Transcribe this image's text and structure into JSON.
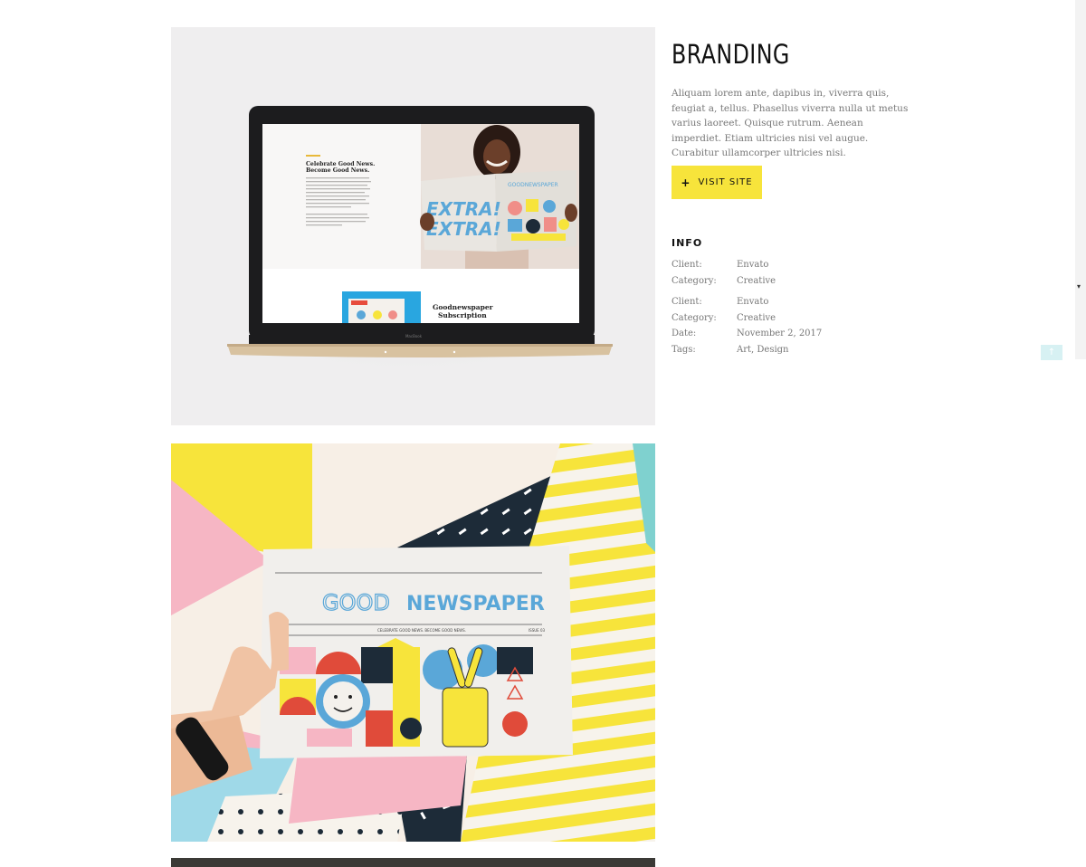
{
  "project": {
    "title": "BRANDING",
    "description": "Aliquam lorem ante, dapibus in, viverra quis, feugiat a, tellus. Phasellus viverra nulla ut metus varius laoreet. Quisque rutrum. Aenean imperdiet. Etiam ultricies nisi vel augue. Curabitur ullamcorper ultricies nisi.",
    "visit_label": "VISIT SITE",
    "visit_icon": "+"
  },
  "info": {
    "title": "INFO",
    "group1": [
      {
        "key": "Client:",
        "value": "Envato"
      },
      {
        "key": "Category:",
        "value": "Creative"
      }
    ],
    "group2": [
      {
        "key": "Client:",
        "value": "Envato"
      },
      {
        "key": "Category:",
        "value": "Creative"
      },
      {
        "key": "Date:",
        "value": "November 2, 2017"
      },
      {
        "key": "Tags:",
        "value": "Art, Design"
      }
    ]
  },
  "laptop_screen": {
    "heading": "Celebrate Good News. Become Good News.",
    "paper_title": "GOODNEWSPAPER",
    "subscription": "Goodnewspaper Subscription",
    "brand": "MacBook",
    "extra": "EXTRA!"
  },
  "newspaper": {
    "masthead_good": "GOOD",
    "masthead_news": "NEWSPAPER",
    "tagline": "CELEBRATE GOOD NEWS. BECOME GOOD NEWS.",
    "issue": "ISSUE 03"
  },
  "colors": {
    "accent_yellow": "#f7e43b",
    "newspaper_blue": "#5aa7d8",
    "pink": "#f6b6c4"
  },
  "icons": {
    "scroll": "triangle-down",
    "back_to_top": "arrow-up"
  }
}
